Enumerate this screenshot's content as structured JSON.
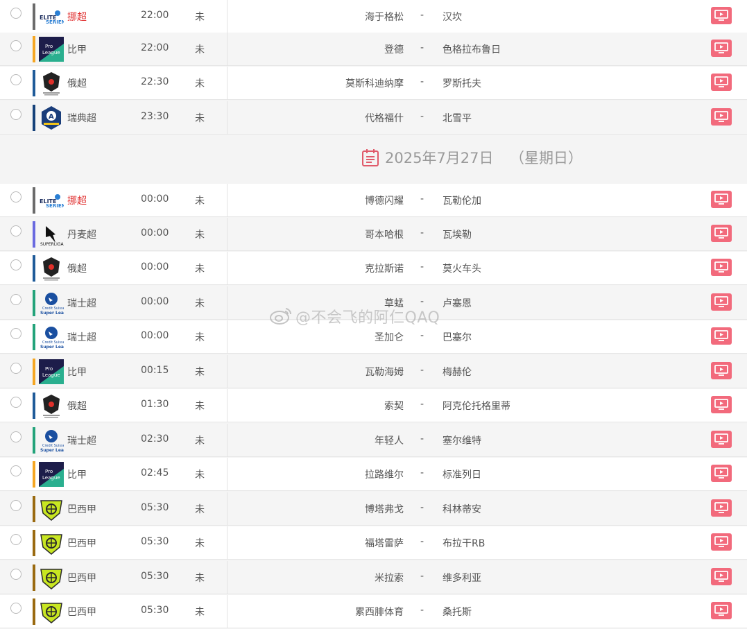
{
  "date_separator": {
    "date": "2025年7月27日",
    "weekday": "（星期日）"
  },
  "watermark": "@不会飞的阿仁QAQ",
  "colors": {
    "tv_button": "#f26a7c",
    "highlight_league": "#e03030"
  },
  "matches": [
    {
      "league": "挪超",
      "league_icon": "eliteserien-logo",
      "bar": "#6b6b6b",
      "time": "22:00",
      "status": "未",
      "home": "海于格松",
      "score": "-",
      "away": "汉坎",
      "highlight": true
    },
    {
      "league": "比甲",
      "league_icon": "pro-league-logo",
      "bar": "#f5a623",
      "time": "22:00",
      "status": "未",
      "home": "登德",
      "score": "-",
      "away": "色格拉布鲁日",
      "highlight": false
    },
    {
      "league": "俄超",
      "league_icon": "russian-premier-league-logo",
      "bar": "#1f5b99",
      "time": "22:30",
      "status": "未",
      "home": "莫斯科迪纳摩",
      "score": "-",
      "away": "罗斯托夫",
      "highlight": false
    },
    {
      "league": "瑞典超",
      "league_icon": "allsvenskan-logo",
      "bar": "#16427a",
      "time": "23:30",
      "status": "未",
      "home": "代格福什",
      "score": "-",
      "away": "北雪平",
      "highlight": false
    },
    {
      "league": "挪超",
      "league_icon": "eliteserien-logo",
      "bar": "#6b6b6b",
      "time": "00:00",
      "status": "未",
      "home": "博德闪耀",
      "score": "-",
      "away": "瓦勒伦加",
      "highlight": true
    },
    {
      "league": "丹麦超",
      "league_icon": "superliga-logo",
      "bar": "#6a6ae0",
      "time": "00:00",
      "status": "未",
      "home": "哥本哈根",
      "score": "-",
      "away": "瓦埃勒",
      "highlight": false
    },
    {
      "league": "俄超",
      "league_icon": "russian-premier-league-logo",
      "bar": "#1f5b99",
      "time": "00:00",
      "status": "未",
      "home": "克拉斯诺",
      "score": "-",
      "away": "莫火车头",
      "highlight": false
    },
    {
      "league": "瑞士超",
      "league_icon": "swiss-super-league-logo",
      "bar": "#23a37a",
      "time": "00:00",
      "status": "未",
      "home": "草蜢",
      "score": "-",
      "away": "卢塞恩",
      "highlight": false
    },
    {
      "league": "瑞士超",
      "league_icon": "swiss-super-league-logo",
      "bar": "#23a37a",
      "time": "00:00",
      "status": "未",
      "home": "圣加仑",
      "score": "-",
      "away": "巴塞尔",
      "highlight": false
    },
    {
      "league": "比甲",
      "league_icon": "pro-league-logo",
      "bar": "#f5a623",
      "time": "00:15",
      "status": "未",
      "home": "瓦勒海姆",
      "score": "-",
      "away": "梅赫伦",
      "highlight": false
    },
    {
      "league": "俄超",
      "league_icon": "russian-premier-league-logo",
      "bar": "#1f5b99",
      "time": "01:30",
      "status": "未",
      "home": "索契",
      "score": "-",
      "away": "阿克伦托格里蒂",
      "highlight": false
    },
    {
      "league": "瑞士超",
      "league_icon": "swiss-super-league-logo",
      "bar": "#23a37a",
      "time": "02:30",
      "status": "未",
      "home": "年轻人",
      "score": "-",
      "away": "塞尔维特",
      "highlight": false
    },
    {
      "league": "比甲",
      "league_icon": "pro-league-logo",
      "bar": "#f5a623",
      "time": "02:45",
      "status": "未",
      "home": "拉路维尔",
      "score": "-",
      "away": "标准列日",
      "highlight": false
    },
    {
      "league": "巴西甲",
      "league_icon": "brasileirao-logo",
      "bar": "#9a6a10",
      "time": "05:30",
      "status": "未",
      "home": "博塔弗戈",
      "score": "-",
      "away": "科林蒂安",
      "highlight": false
    },
    {
      "league": "巴西甲",
      "league_icon": "brasileirao-logo",
      "bar": "#9a6a10",
      "time": "05:30",
      "status": "未",
      "home": "福塔雷萨",
      "score": "-",
      "away": "布拉干RB",
      "highlight": false
    },
    {
      "league": "巴西甲",
      "league_icon": "brasileirao-logo",
      "bar": "#9a6a10",
      "time": "05:30",
      "status": "未",
      "home": "米拉索",
      "score": "-",
      "away": "维多利亚",
      "highlight": false
    },
    {
      "league": "巴西甲",
      "league_icon": "brasileirao-logo",
      "bar": "#9a6a10",
      "time": "05:30",
      "status": "未",
      "home": "累西腓体育",
      "score": "-",
      "away": "桑托斯",
      "highlight": false
    }
  ]
}
